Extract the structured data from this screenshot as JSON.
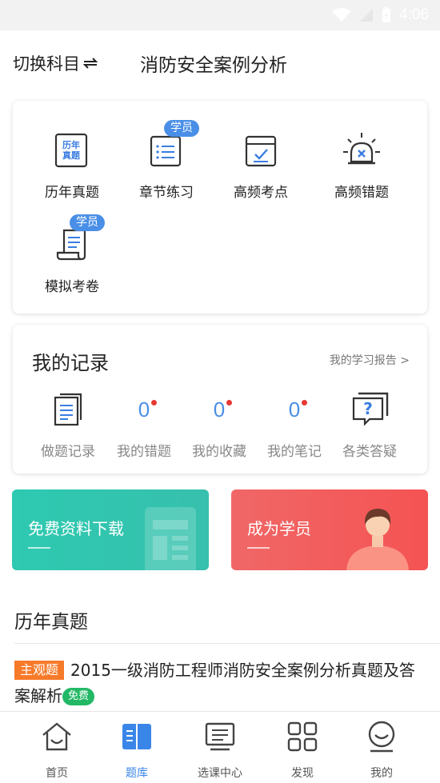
{
  "status_bar": {
    "time": "4:06"
  },
  "header": {
    "switch_label": "切换科目",
    "switch_icon": "swap-arrows-icon",
    "title": "消防安全案例分析"
  },
  "grid": {
    "items": [
      {
        "label": "历年真题",
        "icon": "past-exams-icon",
        "icon_text": "历年真题"
      },
      {
        "label": "章节练习",
        "icon": "chapter-list-icon",
        "badge": "学员"
      },
      {
        "label": "高频考点",
        "icon": "checkbox-icon"
      },
      {
        "label": "高频错题",
        "icon": "alarm-light-icon"
      },
      {
        "label": "模拟考卷",
        "icon": "scroll-paper-icon",
        "badge": "学员"
      }
    ]
  },
  "records": {
    "title": "我的记录",
    "report_link": "我的学习报告 >",
    "items": [
      {
        "label": "做题记录",
        "icon": "doc-list-icon"
      },
      {
        "label": "我的错题",
        "count": "0"
      },
      {
        "label": "我的收藏",
        "count": "0"
      },
      {
        "label": "我的笔记",
        "count": "0"
      },
      {
        "label": "各类答疑",
        "icon": "question-bubble-icon"
      }
    ]
  },
  "banners": {
    "download": "免费资料下载",
    "member": "成为学员"
  },
  "section": {
    "title": "历年真题"
  },
  "article": {
    "tag": "主观题",
    "title": "2015一级消防工程师消防安全案例分析真题及答案解析",
    "badge": "免费"
  },
  "tabbar": {
    "items": [
      {
        "label": "首页",
        "icon": "home-icon"
      },
      {
        "label": "题库",
        "icon": "question-bank-icon",
        "active": true
      },
      {
        "label": "选课中心",
        "icon": "course-center-icon"
      },
      {
        "label": "发现",
        "icon": "grid-discover-icon"
      },
      {
        "label": "我的",
        "icon": "profile-icon"
      }
    ]
  },
  "colors": {
    "accent": "#4a8fe7",
    "teal": "#2ec9b0",
    "red": "#f55353",
    "orange": "#f77a2a",
    "green": "#23b866"
  }
}
